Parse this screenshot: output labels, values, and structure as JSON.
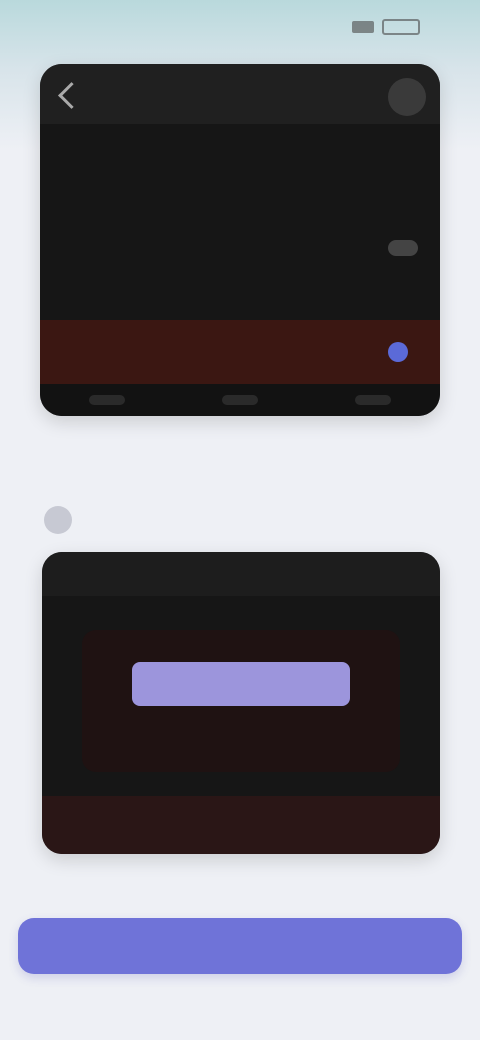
{
  "status": {
    "time": "",
    "icons": [
      "signal-icon",
      "battery-icon"
    ]
  },
  "mock1": {
    "title": "",
    "rows": [
      "",
      ""
    ],
    "section_label": "",
    "highlight_label": "",
    "nav_items": [
      "",
      "",
      ""
    ]
  },
  "step": {
    "number": "",
    "text": ""
  },
  "mock2": {
    "title": "",
    "dialog_button": "",
    "dialog_text": "",
    "footer_text": ""
  },
  "cta": {
    "label": ""
  },
  "colors": {
    "accent": "#6f73d8",
    "dialog_accent": "#9c95dc",
    "dark_bg": "#161616",
    "highlight_bg": "#3b1712"
  }
}
